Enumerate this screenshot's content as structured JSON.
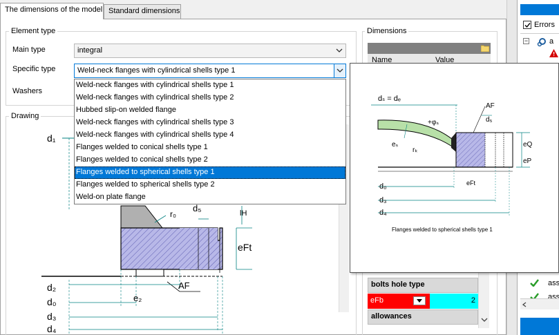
{
  "tabs": [
    {
      "label": "The dimensions of the model"
    },
    {
      "label": "Standard dimensions"
    }
  ],
  "element_type": {
    "group_label": "Element type",
    "main_type_label": "Main type",
    "main_type_value": "integral",
    "specific_type_label": "Specific type",
    "specific_type_value": "Weld-neck flanges with cylindrical shells type 1",
    "washers_label": "Washers"
  },
  "specific_type_options": [
    "Weld-neck flanges with cylindrical shells type 1",
    "Weld-neck flanges with cylindrical shells type 2",
    "Hubbed slip-on welded flange",
    "Weld-neck flanges with cylindrical shells type 3",
    "Weld-neck flanges with cylindrical shells type 4",
    "Flanges welded to conical shells type 1",
    "Flanges welded to conical shells type 2",
    "Flanges welded to spherical shells type 1",
    "Flanges welded to spherical shells type 2",
    "Weld-on plate flange"
  ],
  "highlighted_option_index": 7,
  "drawing": {
    "group_label": "Drawing",
    "labels": {
      "d1": "d₁",
      "r0": "r₀",
      "d5": "d₅",
      "lH": "lH",
      "eFt": "eFt",
      "AF": "AF",
      "d2": "d₂",
      "e2": "e₂",
      "d0": "d₀",
      "d3": "d₃",
      "d4": "d₄"
    }
  },
  "dimensions": {
    "group_label": "Dimensions",
    "col_name": "Name",
    "col_value": "Value",
    "bolts_hole_type_label": "bolts hole type",
    "efb_name": "eFb",
    "efb_value": "2",
    "allowances_label": "allowances"
  },
  "preview": {
    "caption": "Flanges welded to spherical shells type 1",
    "labels": {
      "ds": "dₛ = dₑ",
      "AF": "AF",
      "phi": "+φₛ",
      "d5": "d₅",
      "es": "eₛ",
      "rk": "rₖ",
      "eQ": "eQ",
      "eP": "eP",
      "d0": "d₀",
      "eFt": "eFt",
      "d3": "d₃",
      "d4": "d₄"
    }
  },
  "right_pane": {
    "errors_label": "Errors",
    "item1": "a",
    "item_ass1": "ass",
    "item_ass2": "ass"
  },
  "colors": {
    "accent": "#0078d7",
    "hatch_fill": "#b8b8e8",
    "shell_fill": "#b8e0a8",
    "efb_bg": "#ff0000",
    "value_bg": "#00ffff",
    "dim_line": "#008080"
  }
}
